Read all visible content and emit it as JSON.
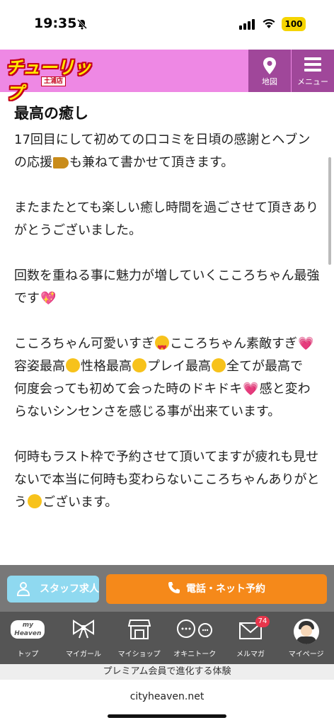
{
  "status": {
    "time": "19:35",
    "battery": "100"
  },
  "header": {
    "logo_text": "チューリップ",
    "logo_sub": "土浦店",
    "map_label": "地図",
    "menu_label": "メニュー"
  },
  "review": {
    "title": "最高の癒し",
    "line1a": "17回目にして初めての口コミを日頃の感謝とヘブンの応援",
    "line1b": "も兼ねて書かせて頂きます。",
    "line2": "またまたとても楽しい癒し時間を過ごさせて頂きありがとうございました。",
    "line3": "回数を重ねる事に魅力が増していくこころちゃん最強です",
    "line4a": "こころちゃん可愛いすぎ",
    "line4b": "こころちゃん素敵すぎ",
    "line5a": "容姿最高",
    "line5b": "性格最高",
    "line5c": "プレイ最高",
    "line5d": "全てが最高で",
    "line6a": "何度会っても初めて会った時のドキドキ",
    "line6b": "感と変わらないシンセンさを感じる事が出来ています。",
    "line7a": "何時もラスト枠で予約させて頂いてますが疲れも見せないで本当に何時も変わらないこころちゃんありがとう",
    "line7b": "ございます。"
  },
  "cta": {
    "staff_label": "スタッフ求人",
    "call_label": "電話・ネット予約"
  },
  "nav": {
    "items": [
      {
        "label": "トップ",
        "icon": "my-heaven-icon"
      },
      {
        "label": "マイガール",
        "icon": "ribbon-icon"
      },
      {
        "label": "マイショップ",
        "icon": "shop-icon"
      },
      {
        "label": "オキニトーク",
        "icon": "chat-icon"
      },
      {
        "label": "メルマガ",
        "icon": "mail-icon",
        "badge": "74"
      },
      {
        "label": "マイページ",
        "icon": "avatar-icon"
      }
    ],
    "myheaven_text": "my Heaven"
  },
  "premium_text": "プレミアム会員で進化する体験",
  "url": "cityheaven.net"
}
